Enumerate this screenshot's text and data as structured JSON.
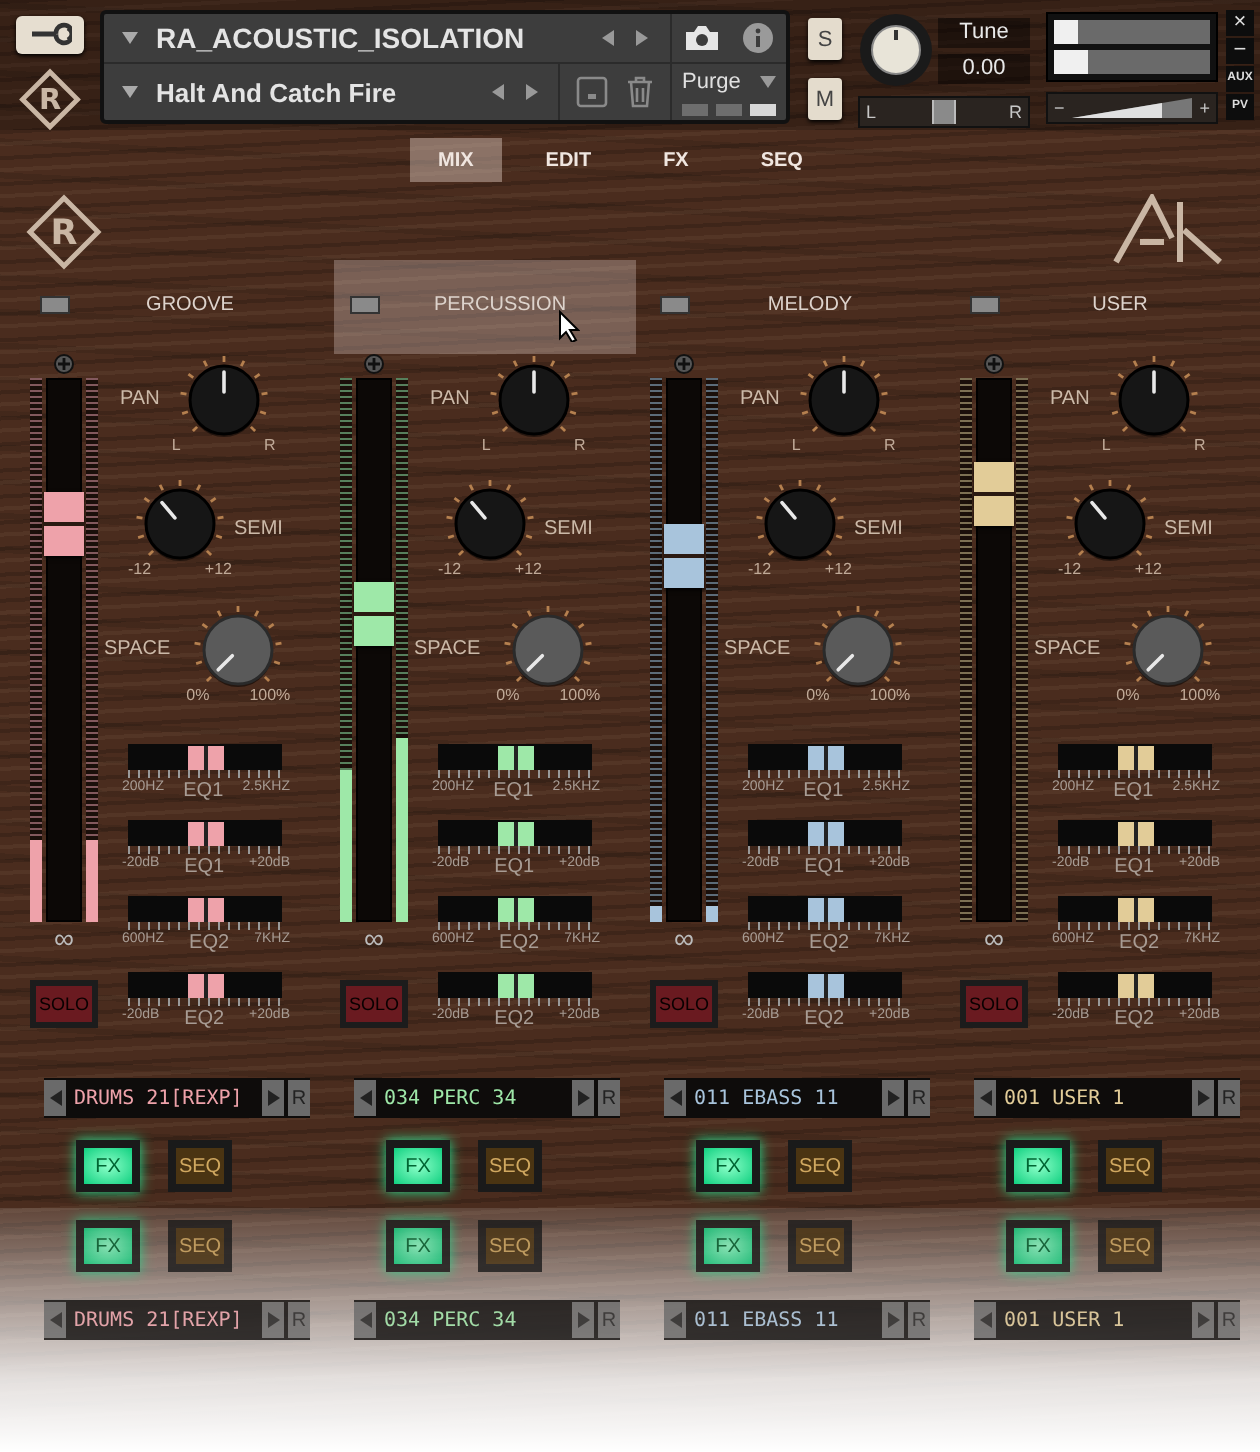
{
  "toolbar": {
    "logo": "R",
    "instrument": "RA_ACOUSTIC_ISOLATION",
    "preset": "Halt And Catch Fire",
    "purge": "Purge",
    "purge_segments": [
      {
        "on": false
      },
      {
        "on": false
      },
      {
        "on": true
      }
    ],
    "solo": "S",
    "mute": "M",
    "tune_label": "Tune",
    "tune_value": "0.00",
    "pan": {
      "left": "L",
      "right": "R",
      "level": 0.5
    },
    "output_meters": [
      {
        "level": 0.16
      },
      {
        "level": 0.22
      }
    ],
    "volume": {
      "minus": "−",
      "plus": "+"
    },
    "side_buttons": [
      "×",
      "−",
      "AUX",
      "PV"
    ]
  },
  "tabs": [
    {
      "label": "MIX",
      "selected": true
    },
    {
      "label": "EDIT",
      "selected": false
    },
    {
      "label": "FX",
      "selected": false
    },
    {
      "label": "SEQ",
      "selected": false
    }
  ],
  "brand_logo": "R",
  "channels": [
    {
      "name": "GROOVE",
      "led_on": false,
      "hovered": false,
      "color": "#eea2aa",
      "meters": [
        {
          "level": 0.15
        },
        {
          "level": 0.15
        }
      ],
      "fader": {
        "level": 0.76
      },
      "link": "∞",
      "pan": {
        "label": "PAN",
        "left": "L",
        "right": "R"
      },
      "semi": {
        "label": "SEMI",
        "min": "-12",
        "max": "+12"
      },
      "space": {
        "label": "SPACE",
        "min": "0%",
        "max": "100%"
      },
      "eq": [
        {
          "left": "200HZ",
          "name": "EQ1",
          "right": "2.5KHZ",
          "level": 0.5
        },
        {
          "left": "-20dB",
          "name": "EQ1",
          "right": "+20dB",
          "level": 0.5
        },
        {
          "left": "600HZ",
          "name": "EQ2",
          "right": "7KHZ",
          "level": 0.5
        },
        {
          "left": "-20dB",
          "name": "EQ2",
          "right": "+20dB",
          "level": 0.5
        }
      ],
      "solo": {
        "label": "SOLO",
        "on": false
      },
      "preset": {
        "text": "DRUMS 21[REXP]",
        "reset": "R"
      },
      "fx": {
        "label": "FX",
        "on": true
      },
      "seq": {
        "label": "SEQ",
        "on": false
      }
    },
    {
      "name": "PERCUSSION",
      "led_on": false,
      "hovered": true,
      "color": "#9ee8a8",
      "meters": [
        {
          "level": 0.28
        },
        {
          "level": 0.34
        }
      ],
      "fader": {
        "level": 0.57
      },
      "link": "∞",
      "pan": {
        "label": "PAN",
        "left": "L",
        "right": "R"
      },
      "semi": {
        "label": "SEMI",
        "min": "-12",
        "max": "+12"
      },
      "space": {
        "label": "SPACE",
        "min": "0%",
        "max": "100%"
      },
      "eq": [
        {
          "left": "200HZ",
          "name": "EQ1",
          "right": "2.5KHZ",
          "level": 0.5
        },
        {
          "left": "-20dB",
          "name": "EQ1",
          "right": "+20dB",
          "level": 0.5
        },
        {
          "left": "600HZ",
          "name": "EQ2",
          "right": "7KHZ",
          "level": 0.5
        },
        {
          "left": "-20dB",
          "name": "EQ2",
          "right": "+20dB",
          "level": 0.5
        }
      ],
      "solo": {
        "label": "SOLO",
        "on": false
      },
      "preset": {
        "text": "034 PERC 34",
        "reset": "R"
      },
      "fx": {
        "label": "FX",
        "on": true
      },
      "seq": {
        "label": "SEQ",
        "on": false
      }
    },
    {
      "name": "MELODY",
      "led_on": false,
      "hovered": false,
      "color": "#a8c4dc",
      "meters": [
        {
          "level": 0.03
        },
        {
          "level": 0.03
        }
      ],
      "fader": {
        "level": 0.69
      },
      "link": "∞",
      "pan": {
        "label": "PAN",
        "left": "L",
        "right": "R"
      },
      "semi": {
        "label": "SEMI",
        "min": "-12",
        "max": "+12"
      },
      "space": {
        "label": "SPACE",
        "min": "0%",
        "max": "100%"
      },
      "eq": [
        {
          "left": "200HZ",
          "name": "EQ1",
          "right": "2.5KHZ",
          "level": 0.5
        },
        {
          "left": "-20dB",
          "name": "EQ1",
          "right": "+20dB",
          "level": 0.5
        },
        {
          "left": "600HZ",
          "name": "EQ2",
          "right": "7KHZ",
          "level": 0.5
        },
        {
          "left": "-20dB",
          "name": "EQ2",
          "right": "+20dB",
          "level": 0.5
        }
      ],
      "solo": {
        "label": "SOLO",
        "on": false
      },
      "preset": {
        "text": "011 EBASS 11",
        "reset": "R"
      },
      "fx": {
        "label": "FX",
        "on": true
      },
      "seq": {
        "label": "SEQ",
        "on": false
      }
    },
    {
      "name": "USER",
      "led_on": false,
      "hovered": false,
      "color": "#e2cc98",
      "meters": [
        {
          "level": 0
        },
        {
          "level": 0
        }
      ],
      "fader": {
        "level": 0.82
      },
      "link": "∞",
      "pan": {
        "label": "PAN",
        "left": "L",
        "right": "R"
      },
      "semi": {
        "label": "SEMI",
        "min": "-12",
        "max": "+12"
      },
      "space": {
        "label": "SPACE",
        "min": "0%",
        "max": "100%"
      },
      "eq": [
        {
          "left": "200HZ",
          "name": "EQ1",
          "right": "2.5KHZ",
          "level": 0.5
        },
        {
          "left": "-20dB",
          "name": "EQ1",
          "right": "+20dB",
          "level": 0.5
        },
        {
          "left": "600HZ",
          "name": "EQ2",
          "right": "7KHZ",
          "level": 0.5
        },
        {
          "left": "-20dB",
          "name": "EQ2",
          "right": "+20dB",
          "level": 0.5
        }
      ],
      "solo": {
        "label": "SOLO",
        "on": false
      },
      "preset": {
        "text": "001 USER 1",
        "reset": "R"
      },
      "fx": {
        "label": "FX",
        "on": true
      },
      "seq": {
        "label": "SEQ",
        "on": false
      }
    }
  ],
  "reflection": [
    {
      "fx": {
        "label": "FX",
        "on": true
      },
      "seq": {
        "label": "SEQ",
        "on": false
      },
      "preset": {
        "text": "DRUMS 21[REXP]",
        "reset": "R"
      }
    },
    {
      "fx": {
        "label": "FX",
        "on": true
      },
      "seq": {
        "label": "SEQ",
        "on": false
      },
      "preset": {
        "text": "034 PERC 34",
        "reset": "R"
      }
    },
    {
      "fx": {
        "label": "FX",
        "on": true
      },
      "seq": {
        "label": "SEQ",
        "on": false
      },
      "preset": {
        "text": "011 EBASS 11",
        "reset": "R"
      }
    },
    {
      "fx": {
        "label": "FX",
        "on": true
      },
      "seq": {
        "label": "SEQ",
        "on": false
      },
      "preset": {
        "text": "001 USER 1",
        "reset": "R"
      }
    }
  ]
}
